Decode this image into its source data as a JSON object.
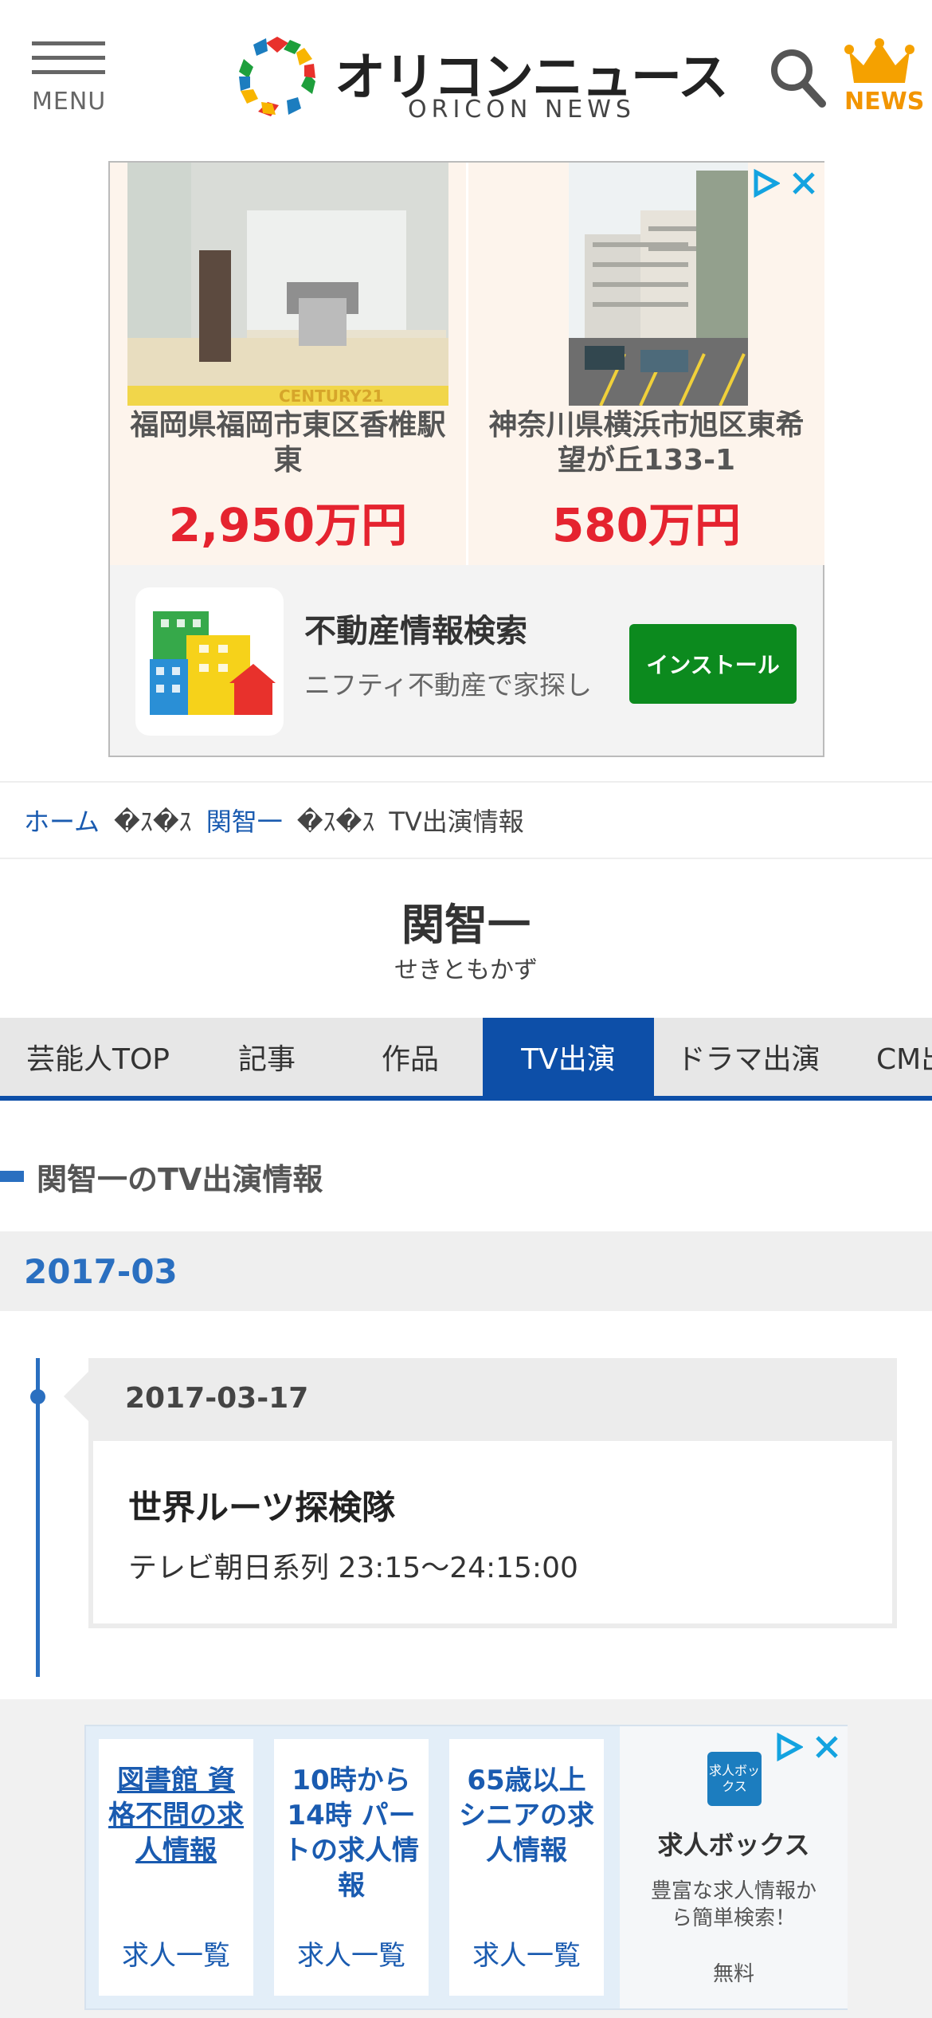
{
  "header": {
    "menu_label": "MENU",
    "logo_jp": "オリコンニュース",
    "logo_en": "ORICON NEWS",
    "news_label": "NEWS"
  },
  "ad_top": {
    "listings": [
      {
        "title": "福岡県福岡市東区香椎駅東",
        "price": "2,950万円",
        "photo_watermark": "CENTURY21"
      },
      {
        "title": "神奈川県横浜市旭区東希望が丘133-1",
        "price": "580万円"
      }
    ],
    "app_name": "不動産情報検索",
    "app_desc": "ニフティ不動産で家探し",
    "install_label": "インストール"
  },
  "breadcrumb": {
    "home": "ホーム",
    "separator": "�ｽ�ｽ",
    "person": "関智一",
    "current": "TV出演情報"
  },
  "person": {
    "name": "関智一",
    "kana": "せきともかず"
  },
  "tabs": [
    {
      "label": "芸能人TOP",
      "active": false
    },
    {
      "label": "記事",
      "active": false
    },
    {
      "label": "作品",
      "active": false
    },
    {
      "label": "TV出演",
      "active": true
    },
    {
      "label": "ドラマ出演",
      "active": false
    },
    {
      "label": "CM出演",
      "active": false
    }
  ],
  "section": {
    "heading": "関智一のTV出演情報",
    "month": "2017-03"
  },
  "timeline": [
    {
      "date": "2017-03-17",
      "title": "世界ルーツ探検隊",
      "detail": "テレビ朝日系列 23:15〜24:15:00"
    }
  ],
  "ad_bottom": {
    "cards": [
      {
        "text": "図書館 資格不問の求人情報",
        "sub": "求人一覧"
      },
      {
        "text": "10時から14時 パートの求人情報",
        "sub": "求人一覧"
      },
      {
        "text": "65歳以上シニアの求人情報",
        "sub": "求人一覧"
      }
    ],
    "brand_logo": "求人ボックス",
    "brand_name": "求人ボックス",
    "brand_desc": "豊富な求人情報から簡単検索！",
    "brand_free": "無料"
  },
  "colors": {
    "accent_blue": "#0d4fa8",
    "link_blue": "#1a5bb0",
    "price_red": "#e5232f",
    "news_orange": "#f29500",
    "install_green": "#0c8a1e"
  }
}
